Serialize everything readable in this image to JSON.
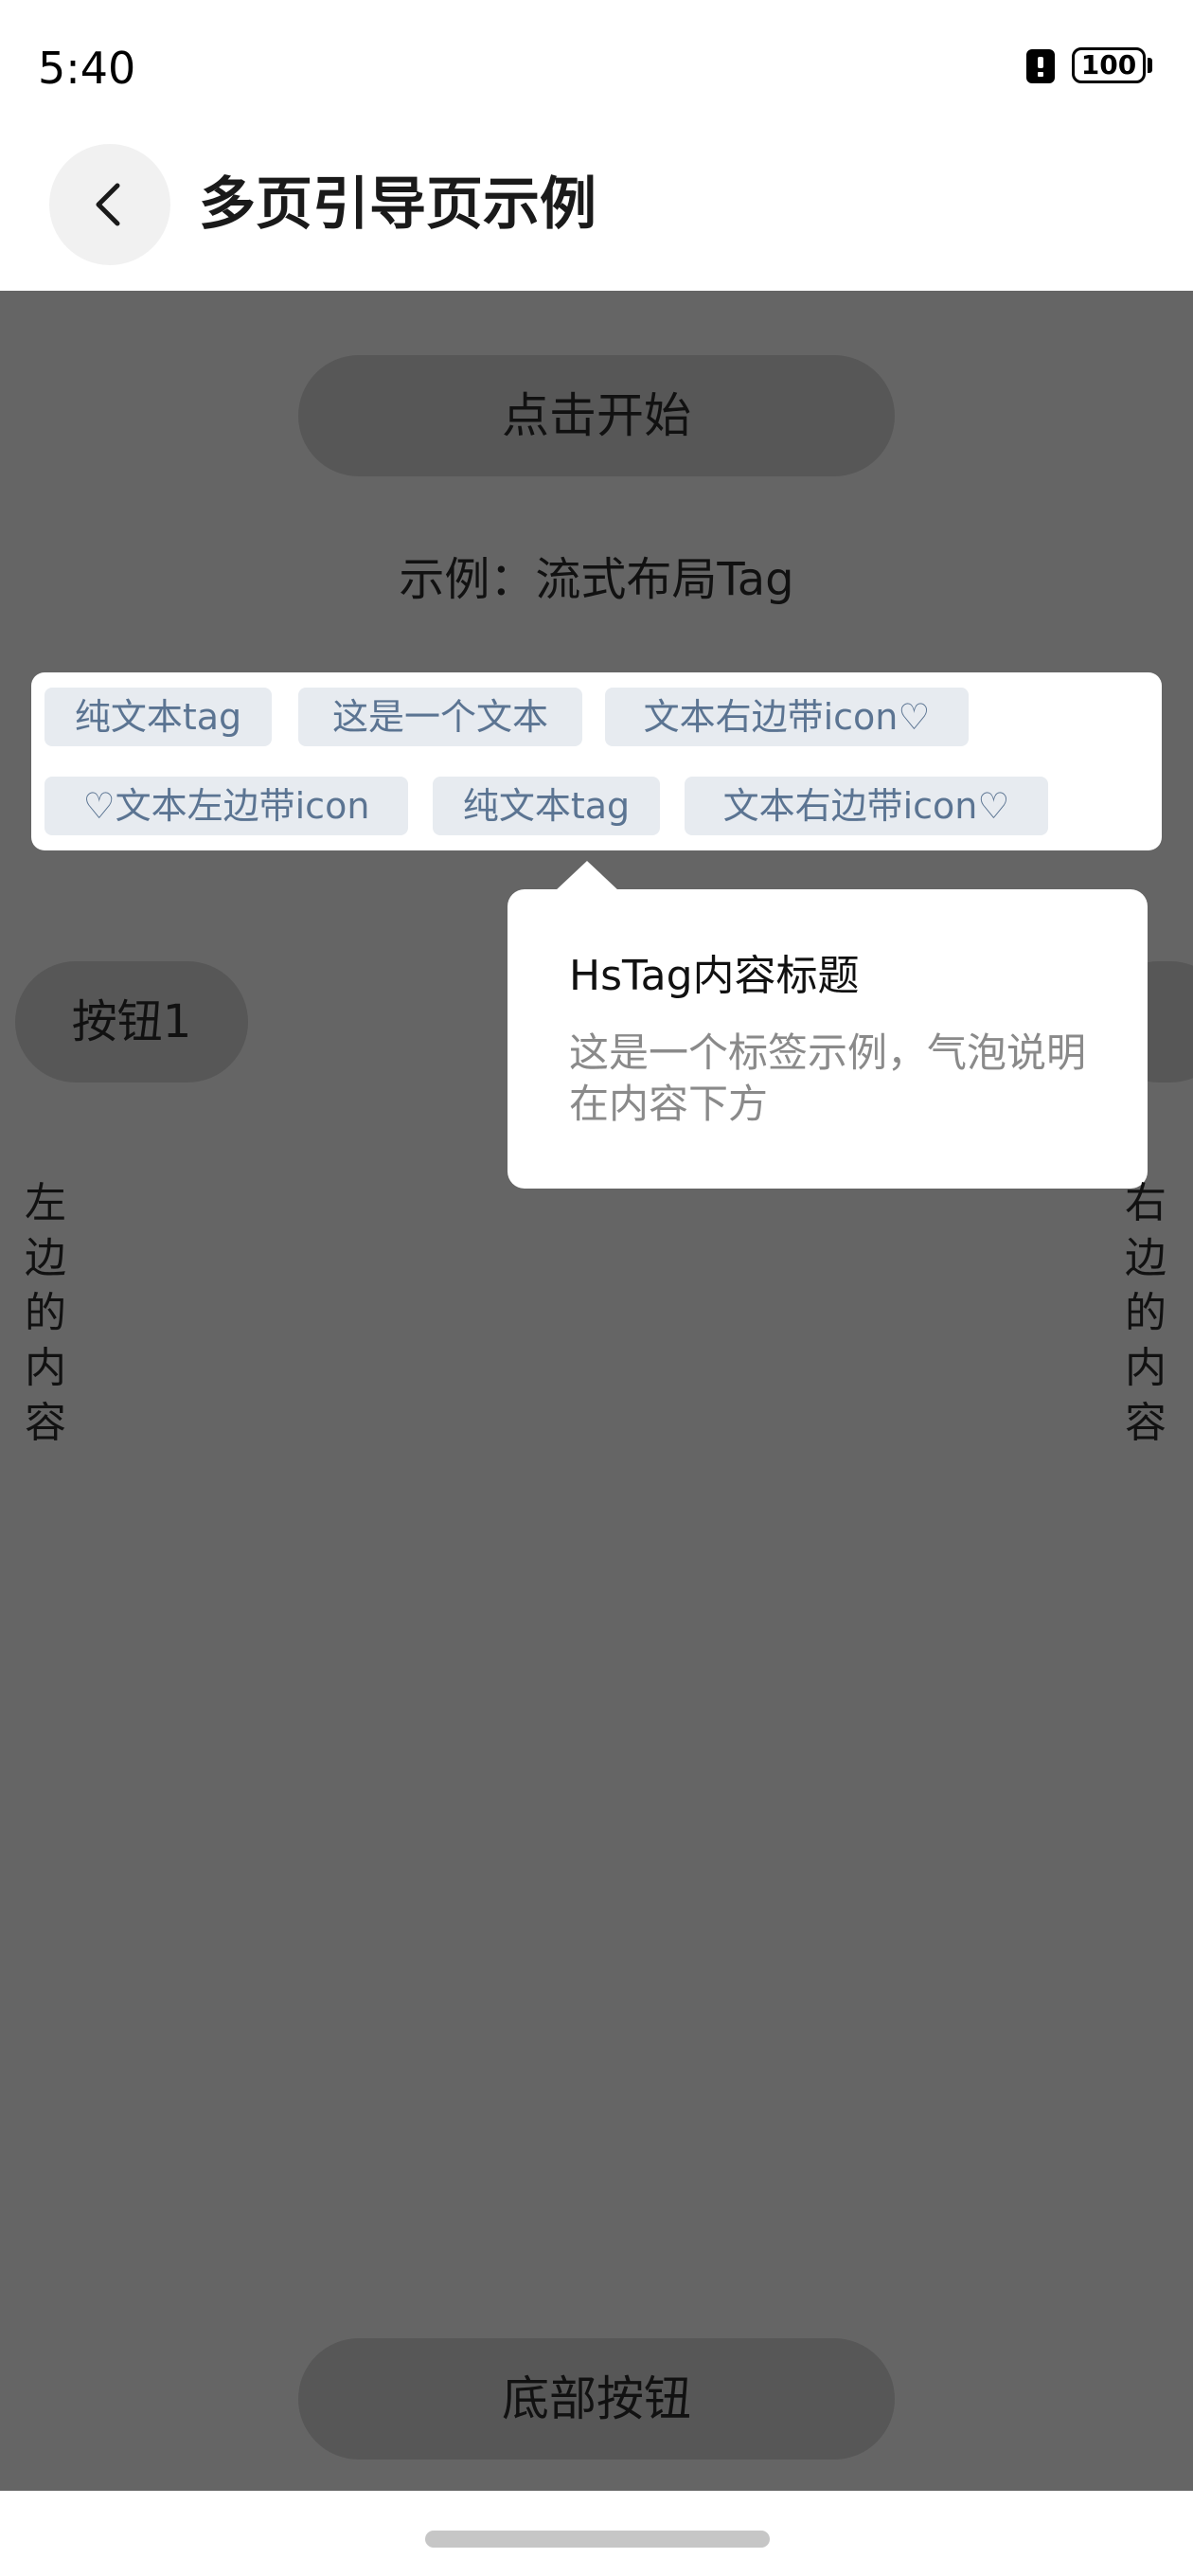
{
  "status_bar": {
    "time": "5:40",
    "battery": "100"
  },
  "app_bar": {
    "title": "多页引导页示例"
  },
  "main": {
    "start_button": "点击开始",
    "example_label": "示例：流式布局Tag",
    "tags": [
      "纯文本tag",
      "这是一个文本",
      "文本右边带icon♡",
      "♡文本左边带icon",
      "纯文本tag",
      "文本右边带icon♡"
    ],
    "bubble": {
      "title": "HsTag内容标题",
      "description": "这是一个标签示例，气泡说明在内容下方"
    },
    "button1": "按钮1",
    "left_content": "左边的内容",
    "right_content": "右边的内容",
    "bottom_button": "底部按钮"
  }
}
